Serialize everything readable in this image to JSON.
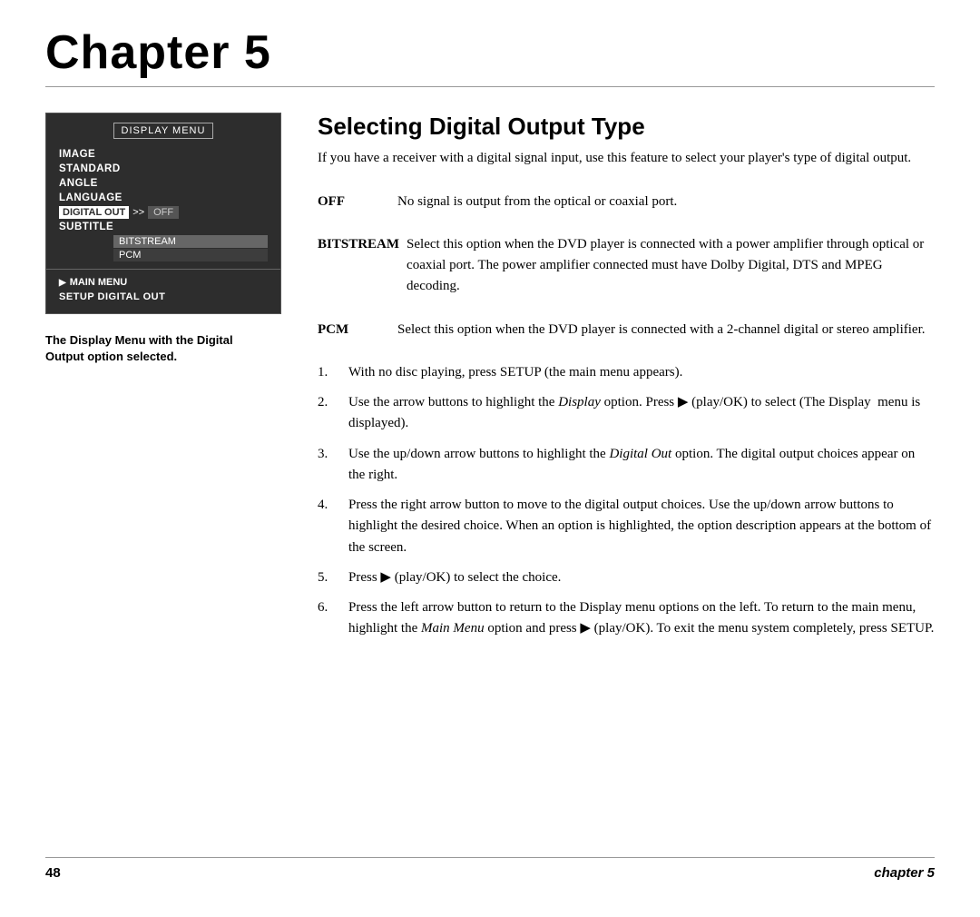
{
  "header": {
    "chapter_label": "Chapter 5"
  },
  "left": {
    "menu": {
      "title": "DISPLAY MENU",
      "items": [
        "IMAGE",
        "STANDARD",
        "ANGLE",
        "LANGUAGE"
      ],
      "digital_out_label": "DIGITAL OUT",
      "arrow": ">>",
      "off_label": "OFF",
      "subtitle_label": "SUBTITLE",
      "submenu_items": [
        "BITSTREAM",
        "PCM"
      ],
      "main_menu_label": "MAIN MENU",
      "setup_label": "SETUP DIGITAL OUT"
    },
    "caption_line1": "The Display Menu with the Digital",
    "caption_line2": "Output option selected."
  },
  "right": {
    "section_title": "Selecting Digital Output Type",
    "intro": "If you have a receiver with a digital signal input, use this feature to select your player's type of digital output.",
    "terms": [
      {
        "label": "OFF",
        "desc": "No signal is output from the optical or coaxial port."
      },
      {
        "label": "BITSTREAM",
        "desc": "Select this option when the DVD player is connected with a power amplifier through optical or coaxial port. The power amplifier connected must have Dolby Digital, DTS and MPEG decoding."
      },
      {
        "label": "PCM",
        "desc": "Select this option when the DVD player is connected with a 2-channel digital or stereo amplifier."
      }
    ],
    "steps": [
      {
        "num": "1.",
        "text": "With no disc playing, press SETUP (the main menu appears)."
      },
      {
        "num": "2.",
        "text": "Use the arrow buttons to highlight the Display option. Press ▶ (play/OK) to select (The Display  menu is displayed)."
      },
      {
        "num": "3.",
        "text": "Use the up/down arrow buttons to highlight the Digital Out option. The digital output choices appear on the right."
      },
      {
        "num": "4.",
        "text": "Press the right arrow button to move to the digital output choices. Use the up/down arrow buttons to highlight the desired choice. When an option is highlighted, the option description appears at the bottom of the screen."
      },
      {
        "num": "5.",
        "text": "Press ▶ (play/OK) to select the choice."
      },
      {
        "num": "6.",
        "text": "Press the left arrow button to return to the Display menu options on the left. To return to the main menu, highlight the Main Menu option and press ▶ (play/OK). To exit the menu system completely, press SETUP."
      }
    ]
  },
  "footer": {
    "page_number": "48",
    "chapter_label": "chapter 5"
  }
}
